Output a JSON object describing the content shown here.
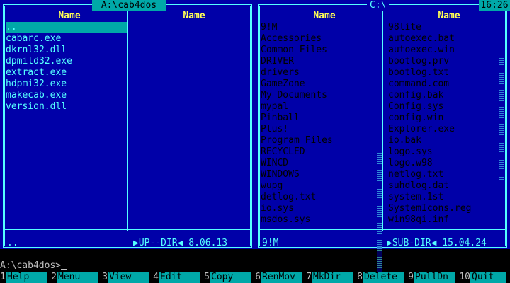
{
  "left_panel": {
    "path": "A:\\cab4dos",
    "column_header": "Name",
    "column2_header": "Name",
    "files": [
      "..",
      "cabarc.exe",
      "dkrnl32.dll",
      "dpmild32.exe",
      "extract.exe",
      "hdpmi32.exe",
      "makecab.exe",
      "version.dll"
    ],
    "selected_index": 0,
    "status_name": "..",
    "status_info": "▶UP--DIR◀  8.06.13"
  },
  "right_panel": {
    "path": "C:\\",
    "column1_header": "Name",
    "column2_header": "Name",
    "column1": [
      "9!M",
      "Accessories",
      "Common Files",
      "DRIVER",
      "drivers",
      "GameZone",
      "My Documents",
      "mypal",
      "Pinball",
      "Plus!",
      "Program Files",
      "RECYCLED",
      "WINCD",
      "WINDOWS",
      "wupg",
      "detlog.txt",
      "io.sys",
      "msdos.sys"
    ],
    "column2": [
      "98lite",
      "autoexec.bat",
      "autoexec.win",
      "bootlog.prv",
      "bootlog.txt",
      "command.com",
      "config.bak",
      "Config.sys",
      "config.win",
      "Explorer.exe",
      "io.bak",
      "logo.sys",
      "logo.w98",
      "netlog.txt",
      "suhdlog.dat",
      "system.1st",
      "SystemIcons.reg",
      "win98qi.inf"
    ],
    "status_name": "9!M",
    "status_info": "▶SUB-DIR◀ 15.04.24"
  },
  "clock": "16:26",
  "command_line": "A:\\cab4dos>",
  "function_keys": [
    {
      "num": "1",
      "label": "Help"
    },
    {
      "num": "2",
      "label": "Menu"
    },
    {
      "num": "3",
      "label": "View"
    },
    {
      "num": "4",
      "label": "Edit"
    },
    {
      "num": "5",
      "label": "Copy"
    },
    {
      "num": "6",
      "label": "RenMov"
    },
    {
      "num": "7",
      "label": "MkDir"
    },
    {
      "num": "8",
      "label": "Delete"
    },
    {
      "num": "9",
      "label": "PullDn"
    },
    {
      "num": "10",
      "label": "Quit"
    }
  ],
  "colors": {
    "panel_bg": "#0000a8",
    "text": "#55ffff",
    "header": "#ffff55",
    "highlight": "#00a8a8"
  }
}
